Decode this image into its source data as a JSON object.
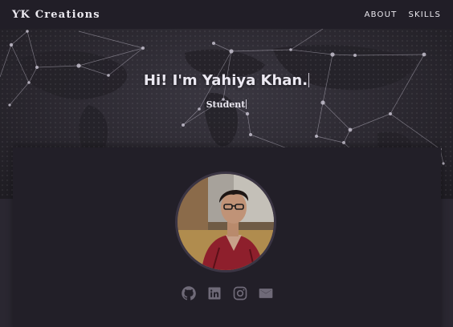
{
  "navbar": {
    "brand": "ƳK Creations",
    "links": [
      {
        "label": "ABOUT"
      },
      {
        "label": "SKILLS"
      }
    ]
  },
  "hero": {
    "title": "Hi! I'm Yahiya Khan.",
    "subtitle": "Student"
  },
  "profile": {
    "social_icons": [
      "github-icon",
      "linkedin-icon",
      "instagram-icon",
      "mail-icon"
    ]
  },
  "colors": {
    "background": "#2a2731",
    "navbar": "#211e27",
    "card": "#221f28",
    "icon": "#6f6a78"
  }
}
